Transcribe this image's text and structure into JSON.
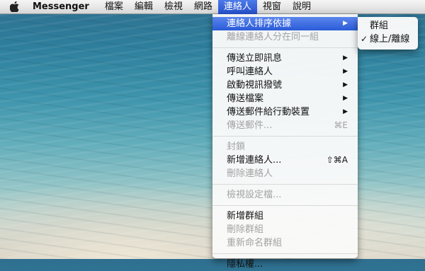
{
  "menubar": {
    "app_name": "Messenger",
    "menus": [
      "檔案",
      "編輯",
      "檢視",
      "網路",
      "連絡人",
      "視窗",
      "說明"
    ]
  },
  "contacts_menu": {
    "items": [
      {
        "label": "連絡人排序依據",
        "arrow": "▶"
      },
      {
        "label": "離線連絡人分在同一組"
      },
      {
        "label": "傳送立即訊息",
        "arrow": "▶"
      },
      {
        "label": "呼叫連絡人",
        "arrow": "▶"
      },
      {
        "label": "啟動視訊撥號",
        "arrow": "▶"
      },
      {
        "label": "傳送檔案",
        "arrow": "▶"
      },
      {
        "label": "傳送郵件給行動裝置",
        "arrow": "▶"
      },
      {
        "label": "傳送郵件...",
        "shortcut": "⌘E"
      },
      {
        "label": "封鎖"
      },
      {
        "label": "新增連絡人...",
        "shortcut": "⇧⌘A"
      },
      {
        "label": "刪除連絡人"
      },
      {
        "label": "檢視設定檔..."
      },
      {
        "label": "新增群組"
      },
      {
        "label": "刪除群組"
      },
      {
        "label": "重新命名群組"
      },
      {
        "label": "隱私權..."
      }
    ]
  },
  "sort_submenu": {
    "items": [
      {
        "label": "群組",
        "checked": ""
      },
      {
        "label": "線上/離線",
        "checked": "✓"
      }
    ]
  }
}
